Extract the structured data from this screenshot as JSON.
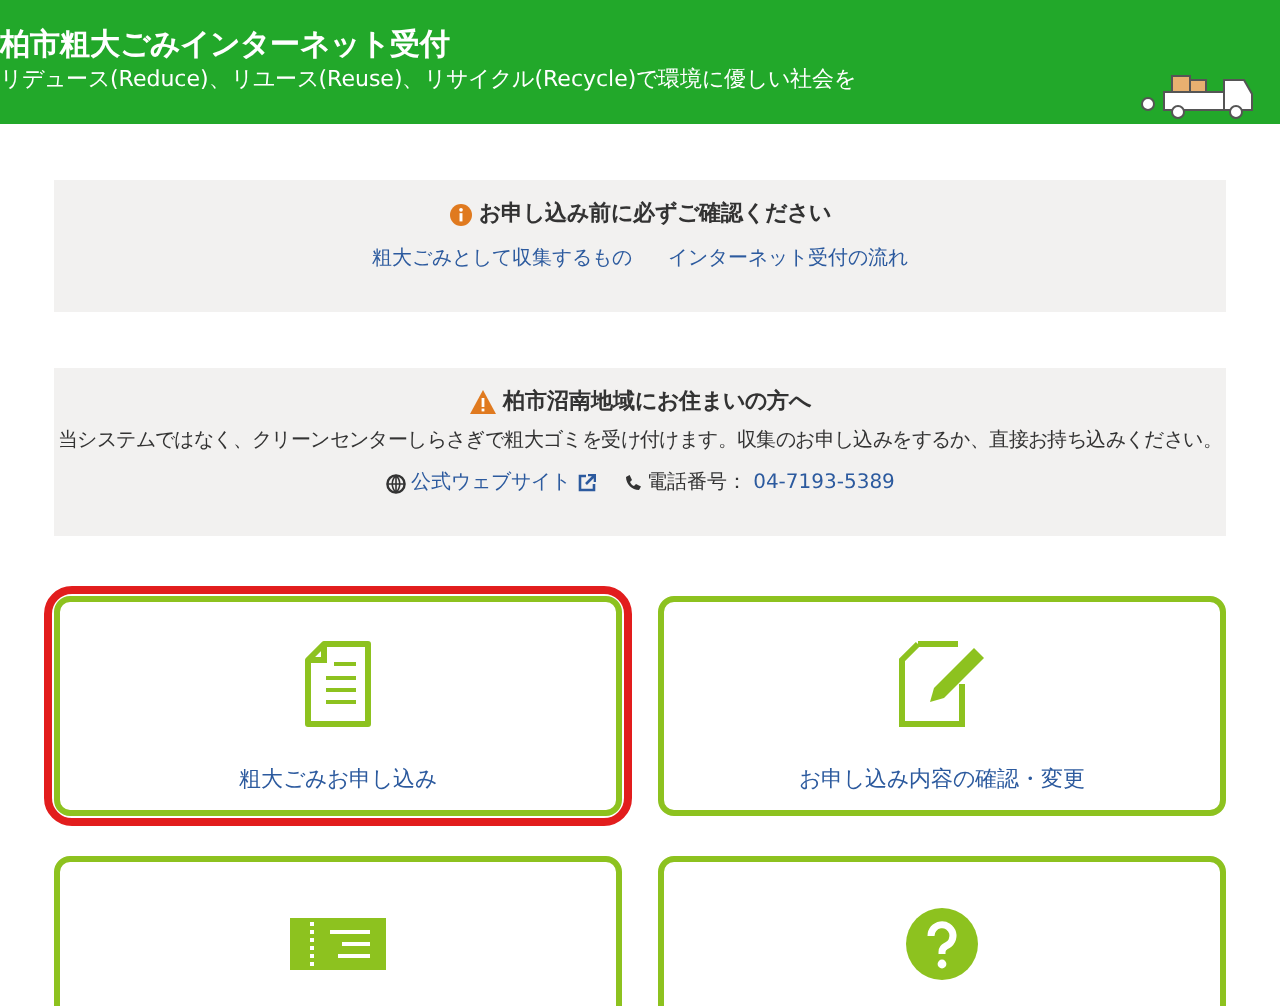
{
  "header": {
    "title": "柏市粗大ごみインターネット受付",
    "subtitle": "リデュース(Reduce)、リユース(Reuse)、リサイクル(Recycle)で環境に優しい社会を"
  },
  "notices": [
    {
      "kind": "info",
      "title": "お申し込み前に必ずご確認ください",
      "links": [
        {
          "text": "粗大ごみとして収集するもの"
        },
        {
          "text": "インターネット受付の流れ"
        }
      ]
    },
    {
      "kind": "warning",
      "title": "柏市沼南地域にお住まいの方へ",
      "body": "当システムではなく、クリーンセンターしらさぎで粗大ゴミを受け付けます。収集のお申し込みをするか、直接お持ち込みください。",
      "website": "公式ウェブサイト",
      "phone_label": "電話番号：",
      "phone": "04-7193-5389"
    }
  ],
  "menu": [
    {
      "kind": "document",
      "label": "粗大ごみお申し込み",
      "highlighted": true
    },
    {
      "kind": "edit",
      "label": "お申し込み内容の確認・変更",
      "highlighted": false
    },
    {
      "kind": "ticket",
      "highlighted": false
    },
    {
      "kind": "question",
      "highlighted": false
    }
  ]
}
